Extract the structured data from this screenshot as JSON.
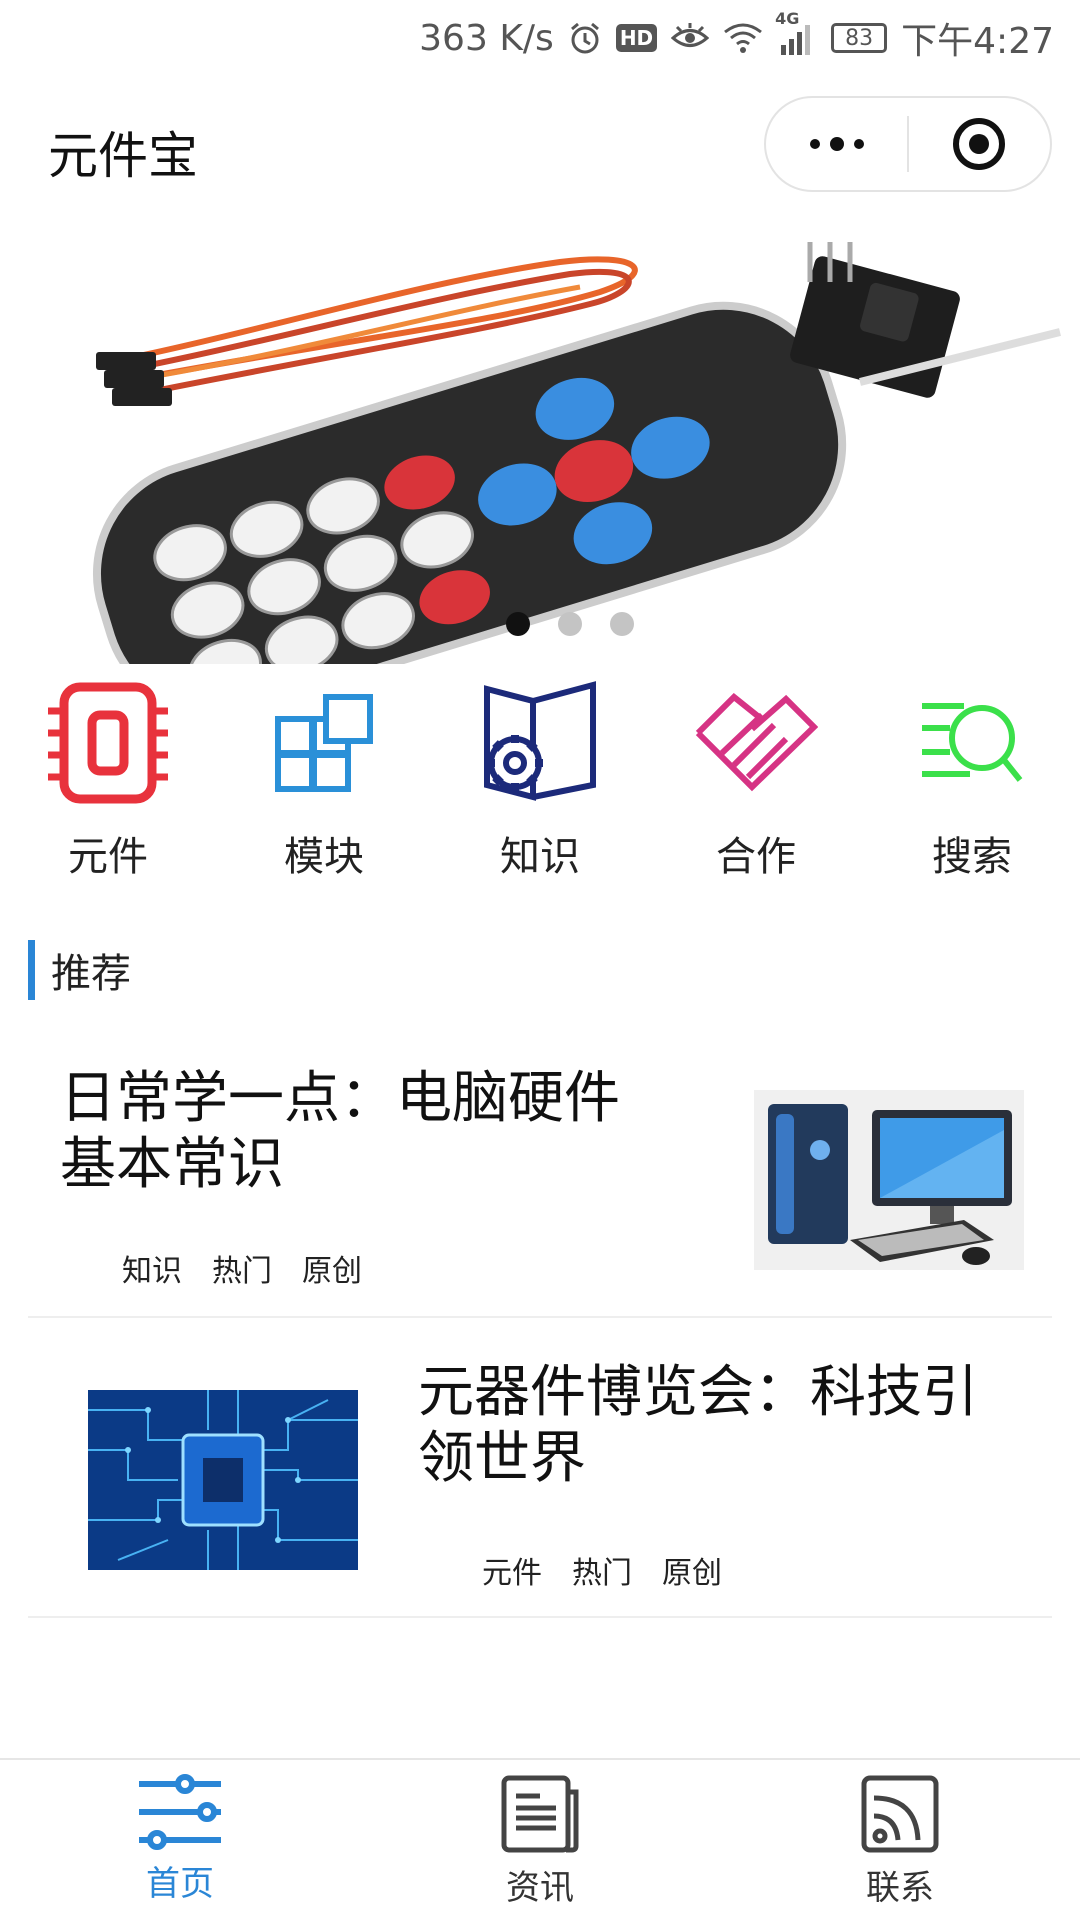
{
  "status_bar": {
    "speed": "363 K/s",
    "hd_label": "HD",
    "network": "4G",
    "battery": "83",
    "time": "下午4:27"
  },
  "header": {
    "title": "元件宝",
    "more_icon": "more-dots-icon",
    "close_icon": "target-close-icon"
  },
  "banner": {
    "image": "ir-remote-control-kit",
    "slide_count": 3,
    "active_slide": 1
  },
  "categories": [
    {
      "label": "元件",
      "icon": "chip-icon",
      "color": "#e8323c"
    },
    {
      "label": "模块",
      "icon": "module-grid-icon",
      "color": "#2a90d8"
    },
    {
      "label": "知识",
      "icon": "book-gear-icon",
      "color": "#1c2a7a"
    },
    {
      "label": "合作",
      "icon": "handshake-icon",
      "color": "#d63384"
    },
    {
      "label": "搜索",
      "icon": "search-icon",
      "color": "#3be04a"
    }
  ],
  "section": {
    "title": "推荐",
    "accent": "#2a86d6"
  },
  "articles": [
    {
      "title": "日常学一点：电脑硬件基本常识",
      "tags": [
        "知识",
        "热门",
        "原创"
      ],
      "thumb": "desktop-computer-image"
    },
    {
      "title": "元器件博览会：科技引领世界",
      "tags": [
        "元件",
        "热门",
        "原创"
      ],
      "thumb": "circuit-board-image"
    }
  ],
  "tab_bar": {
    "tabs": [
      {
        "label": "首页",
        "icon": "sliders-icon",
        "active": true
      },
      {
        "label": "资讯",
        "icon": "news-icon",
        "active": false
      },
      {
        "label": "联系",
        "icon": "rss-icon",
        "active": false
      }
    ],
    "active_color": "#2a86d6"
  }
}
